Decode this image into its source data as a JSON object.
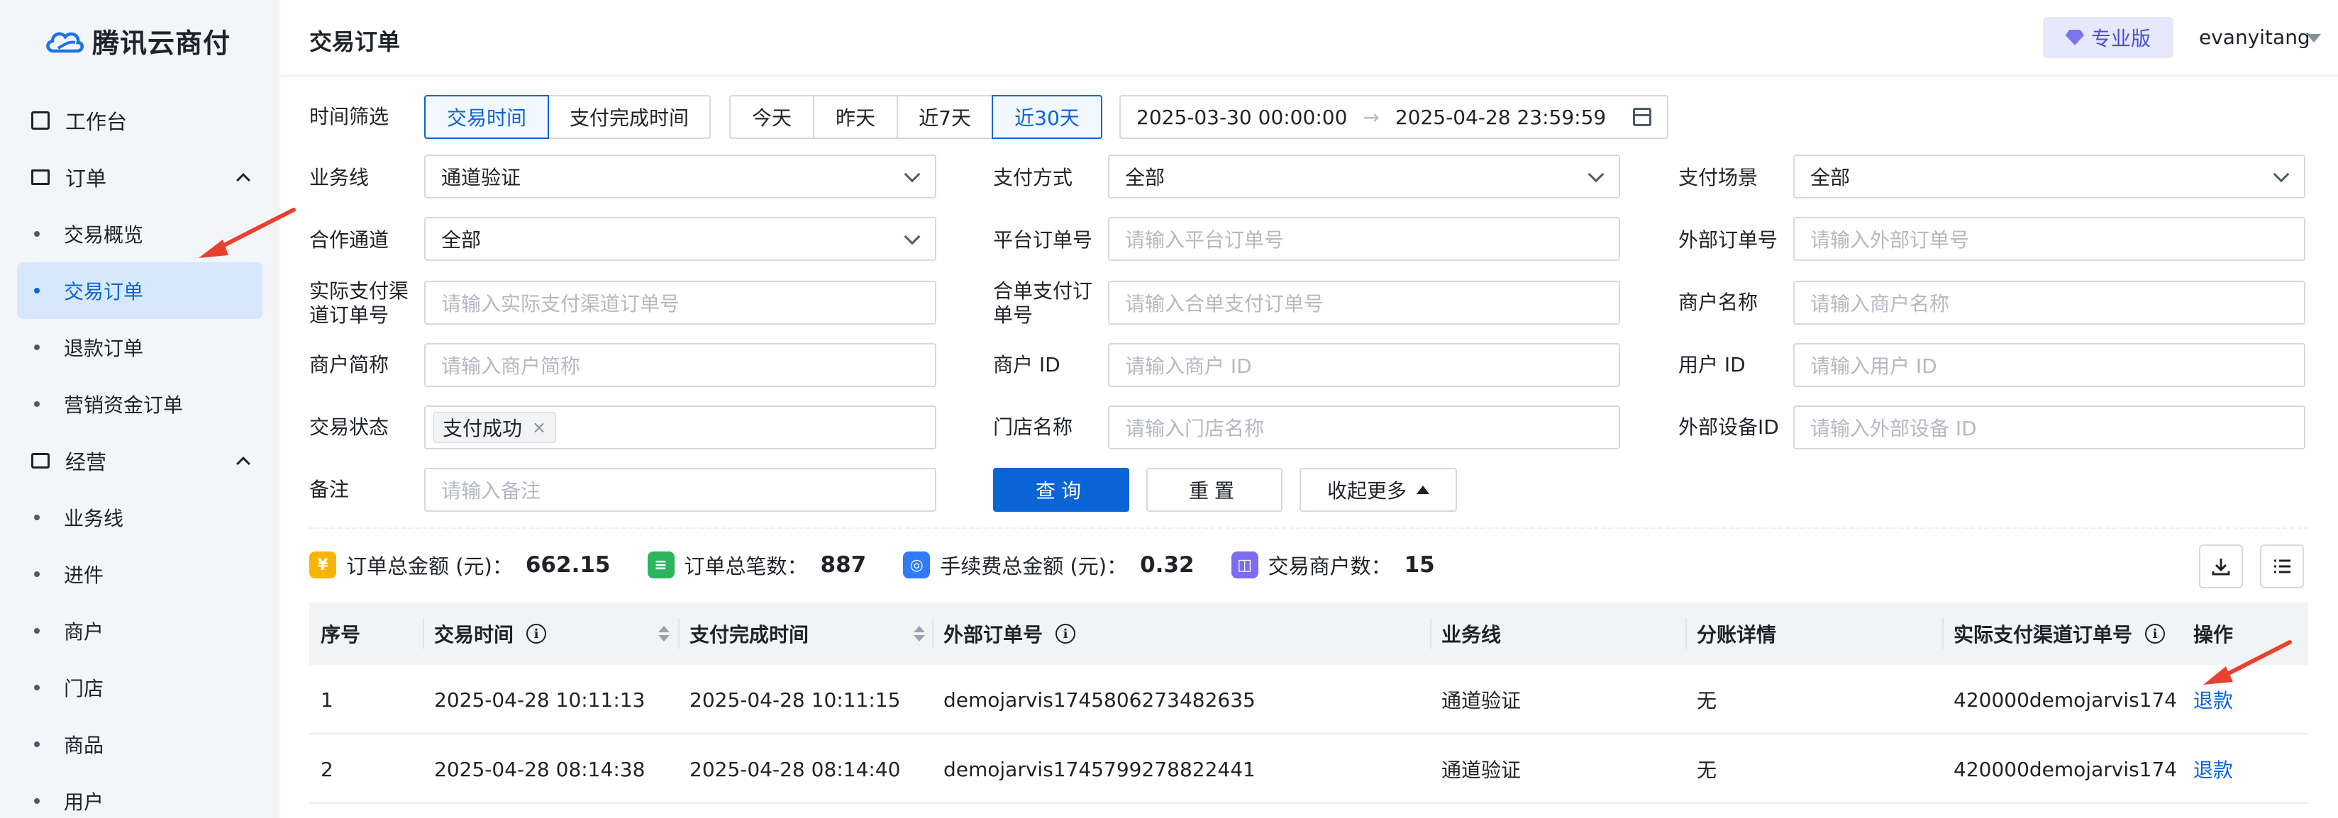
{
  "brand": {
    "name": "腾讯云商付"
  },
  "sidebar": {
    "workbench": "工作台",
    "groups": [
      {
        "label": "订单",
        "items": [
          "交易概览",
          "交易订单",
          "退款订单",
          "营销资金订单"
        ]
      },
      {
        "label": "经营",
        "items": [
          "业务线",
          "进件",
          "商户",
          "门店",
          "商品",
          "用户"
        ]
      }
    ],
    "active": "交易订单"
  },
  "header": {
    "title": "交易订单",
    "edition": "专业版",
    "username": "evanyitang"
  },
  "filters": {
    "time_filter_label": "时间筛选",
    "time_types": [
      "交易时间",
      "支付完成时间"
    ],
    "time_types_active": "交易时间",
    "quick_ranges": [
      "今天",
      "昨天",
      "近7天",
      "近30天"
    ],
    "quick_range_active": "近30天",
    "date_start": "2025-03-30 00:00:00",
    "date_arrow": "→",
    "date_end": "2025-04-28 23:59:59",
    "business_line": {
      "label": "业务线",
      "value": "通道验证"
    },
    "pay_method": {
      "label": "支付方式",
      "value": "全部"
    },
    "pay_scene": {
      "label": "支付场景",
      "value": "全部"
    },
    "partner_channel": {
      "label": "合作通道",
      "value": "全部"
    },
    "platform_order": {
      "label": "平台订单号",
      "placeholder": "请输入平台订单号"
    },
    "external_order": {
      "label": "外部订单号",
      "placeholder": "请输入外部订单号"
    },
    "channel_order": {
      "label": "实际支付渠道订单号",
      "placeholder": "请输入实际支付渠道订单号"
    },
    "combined_order": {
      "label": "合单支付订单号",
      "placeholder": "请输入合单支付订单号"
    },
    "merchant_name": {
      "label": "商户名称",
      "placeholder": "请输入商户名称"
    },
    "merchant_short": {
      "label": "商户简称",
      "placeholder": "请输入商户简称"
    },
    "merchant_id": {
      "label": "商户 ID",
      "placeholder": "请输入商户 ID"
    },
    "user_id": {
      "label": "用户 ID",
      "placeholder": "请输入用户 ID"
    },
    "trade_status": {
      "label": "交易状态",
      "tag": "支付成功",
      "tag_close": "×"
    },
    "store_name": {
      "label": "门店名称",
      "placeholder": "请输入门店名称"
    },
    "device_id": {
      "label": "外部设备ID",
      "placeholder": "请输入外部设备 ID"
    },
    "remark": {
      "label": "备注",
      "placeholder": "请输入备注"
    },
    "query_button": "查询",
    "reset_button": "重置",
    "collapse_button": "收起更多"
  },
  "stats": [
    {
      "label": "订单总金额 (元)：",
      "value": "662.15",
      "icon": "yen-icon",
      "color": "#f7b500",
      "glyph": "¥"
    },
    {
      "label": "订单总笔数：",
      "value": "887",
      "icon": "document-icon",
      "color": "#2db55d",
      "glyph": "≡"
    },
    {
      "label": "手续费总金额 (元)：",
      "value": "0.32",
      "icon": "database-icon",
      "color": "#2f7cf6",
      "glyph": "◎"
    },
    {
      "label": "交易商户数：",
      "value": "15",
      "icon": "merchant-icon",
      "color": "#7b6cf0",
      "glyph": "◫"
    }
  ],
  "table": {
    "columns": [
      "序号",
      "交易时间",
      "支付完成时间",
      "外部订单号",
      "业务线",
      "分账详情",
      "实际支付渠道订单号",
      "操作"
    ],
    "rows": [
      {
        "index": "1",
        "trade_time": "2025-04-28 10:11:13",
        "pay_time": "2025-04-28 10:11:15",
        "external_order": "demojarvis1745806273482635",
        "business_line": "通道验证",
        "split": "无",
        "channel_order": "420000demojarvis174",
        "action": "退款"
      },
      {
        "index": "2",
        "trade_time": "2025-04-28 08:14:38",
        "pay_time": "2025-04-28 08:14:40",
        "external_order": "demojarvis1745799278822441",
        "business_line": "通道验证",
        "split": "无",
        "channel_order": "420000demojarvis174",
        "action": "退款"
      }
    ]
  },
  "colors": {
    "accent": "#0a64d6",
    "annotation_arrow": "#e8412f"
  }
}
